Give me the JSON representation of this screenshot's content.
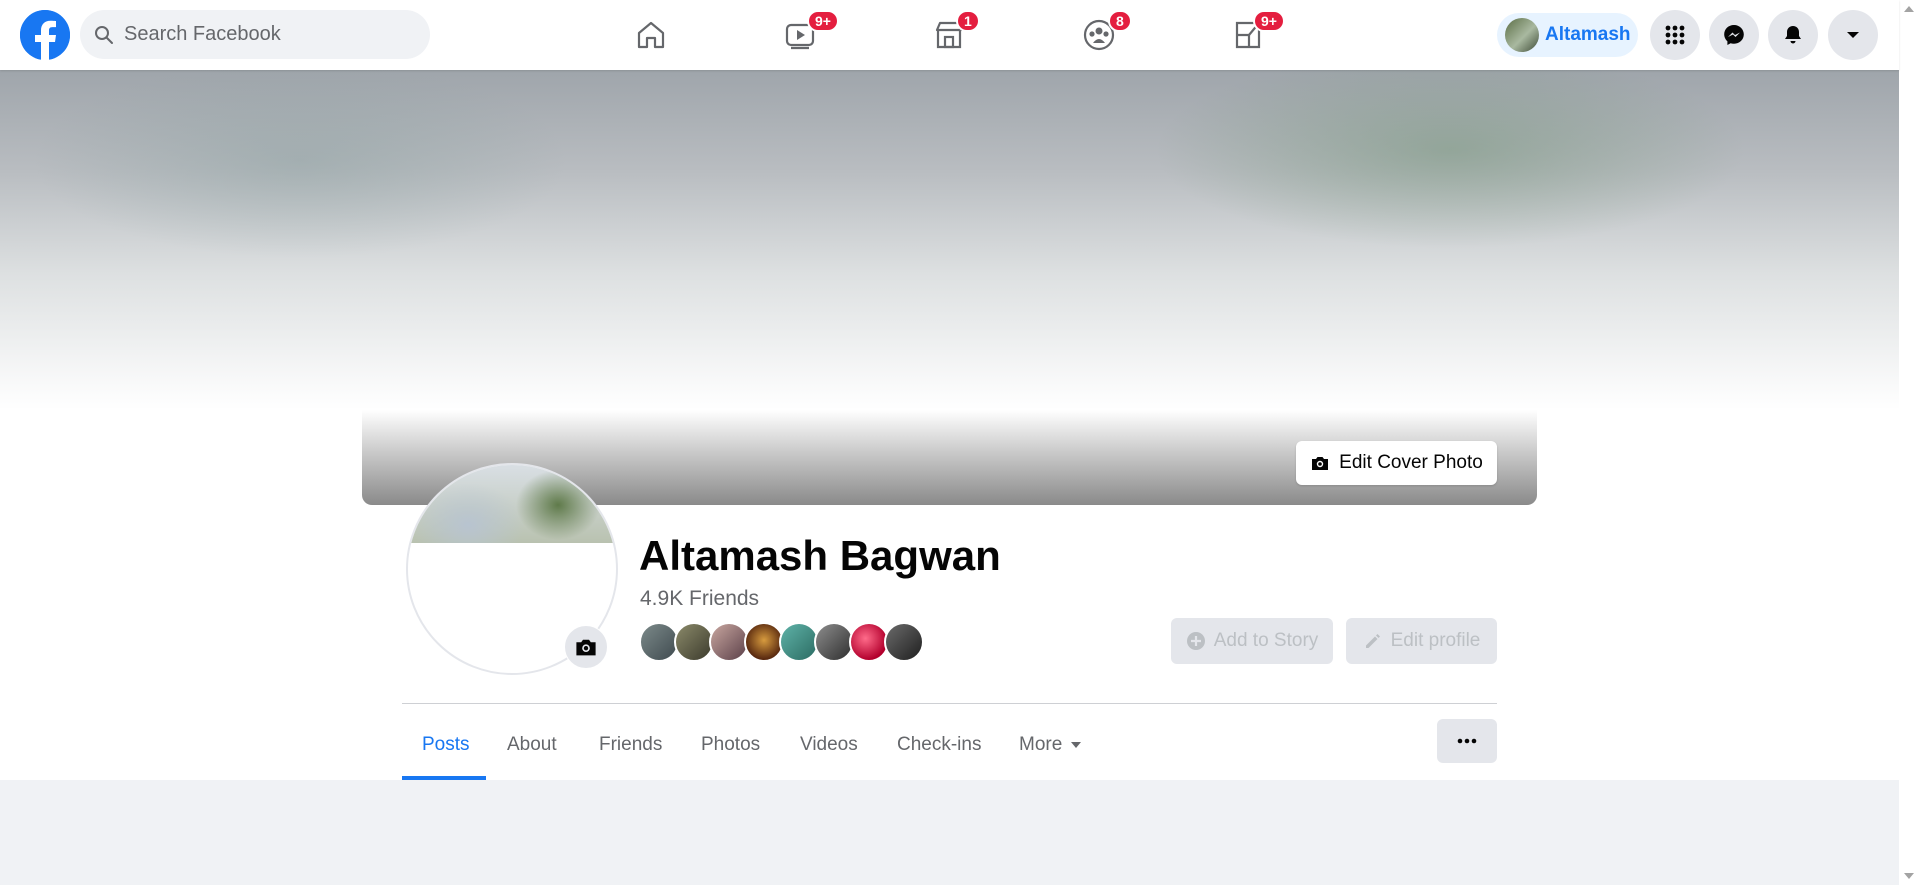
{
  "header": {
    "search_placeholder": "Search Facebook",
    "tabs": [
      {
        "name": "home",
        "badge": ""
      },
      {
        "name": "watch",
        "badge": "9+"
      },
      {
        "name": "marketplace",
        "badge": "1"
      },
      {
        "name": "groups",
        "badge": "8"
      },
      {
        "name": "gaming",
        "badge": "9+"
      }
    ],
    "profile_name": "Altamash"
  },
  "profile": {
    "edit_cover_label": "Edit Cover Photo",
    "full_name": "Altamash Bagwan",
    "friends_count": "4.9K Friends",
    "add_to_story_label": "Add to Story",
    "edit_profile_label": "Edit profile"
  },
  "profile_tabs": [
    {
      "label": "Posts",
      "active": true
    },
    {
      "label": "About"
    },
    {
      "label": "Friends"
    },
    {
      "label": "Photos"
    },
    {
      "label": "Videos"
    },
    {
      "label": "Check-ins"
    },
    {
      "label": "More"
    }
  ],
  "colors": {
    "brand": "#1877f2",
    "badge": "#e41e3f",
    "button_bg": "#e4e6eb"
  }
}
